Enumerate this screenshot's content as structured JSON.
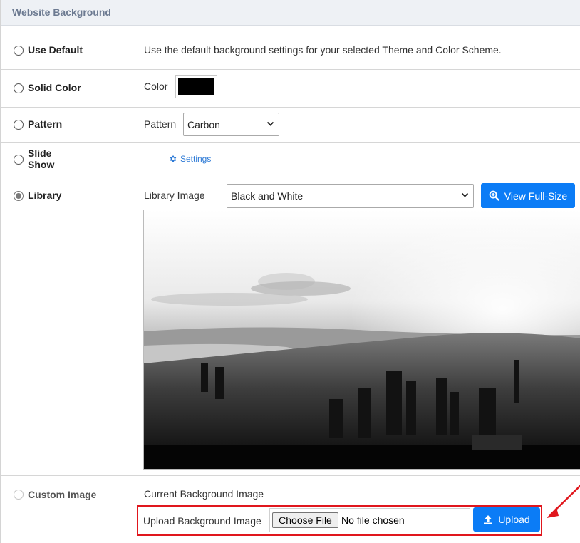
{
  "header": {
    "title": "Website Background"
  },
  "options": {
    "use_default": {
      "label": "Use Default",
      "description": "Use the default background settings for your selected Theme and Color Scheme."
    },
    "solid_color": {
      "label": "Solid Color",
      "field_label": "Color",
      "color": "#000000"
    },
    "pattern": {
      "label": "Pattern",
      "field_label": "Pattern",
      "selected": "Carbon"
    },
    "slide_show": {
      "label_line1": "Slide",
      "label_line2": "Show",
      "settings_link": "Settings"
    },
    "library": {
      "label": "Library",
      "field_label": "Library Image",
      "selected": "Black and White",
      "view_button": "View Full-Size"
    },
    "custom_image": {
      "label": "Custom Image",
      "current_label": "Current Background Image",
      "upload_label": "Upload Background Image",
      "choose_file": "Choose File",
      "file_status": "No file chosen",
      "upload_button": "Upload"
    }
  },
  "selected_option": "library",
  "colors": {
    "accent": "#0b7cf6",
    "highlight": "#e0161d",
    "header_bg": "#eef1f5",
    "header_text": "#6c7a91"
  }
}
